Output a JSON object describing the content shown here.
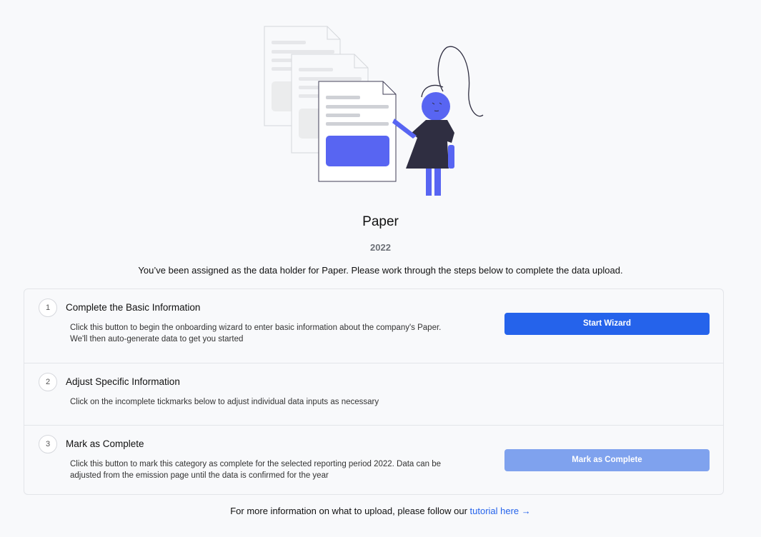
{
  "header": {
    "title": "Paper",
    "year": "2022",
    "intro": "You’ve been assigned as the data holder for Paper. Please work through the steps below to complete the data upload."
  },
  "steps": [
    {
      "number": "1",
      "title": "Complete the Basic Information",
      "description_line1": "Click this button to begin the onboarding wizard to enter basic information about the company's Paper.",
      "description_line2": "We'll then auto-generate data to get you started",
      "button_label": "Start Wizard"
    },
    {
      "number": "2",
      "title": "Adjust Specific Information",
      "description_line1": "Click on the incomplete tickmarks below to adjust individual data inputs as necessary"
    },
    {
      "number": "3",
      "title": "Mark as Complete",
      "description_line1": "Click this button to mark this category as complete for the selected reporting period 2022. Data can be",
      "description_line2": "adjusted from the emission page until the data is confirmed for the year",
      "button_label": "Mark as Complete",
      "button_disabled": true
    }
  ],
  "footer": {
    "text": "For more information on what to upload, please follow our ",
    "link_text": "tutorial here →"
  },
  "colors": {
    "accent": "#2563eb",
    "accent_disabled": "#7fa2ee",
    "illustration_blue": "#5865f2",
    "illustration_dark": "#2f2e41"
  },
  "icons": {
    "illustration": "documents-woman-illustration"
  }
}
